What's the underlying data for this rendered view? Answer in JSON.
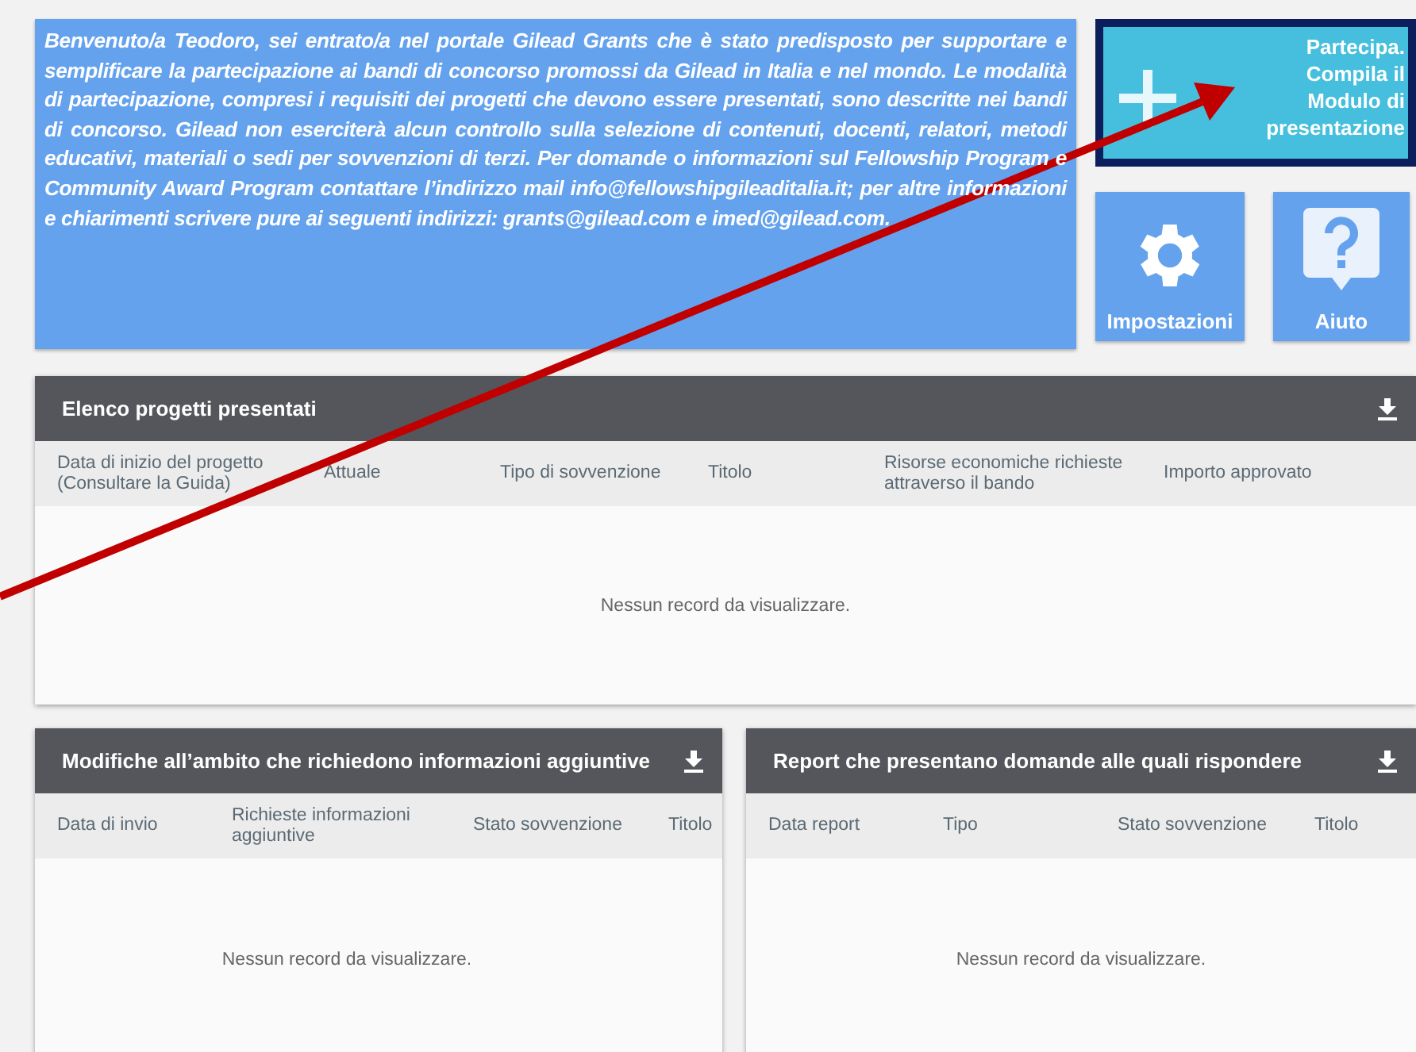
{
  "welcome": {
    "text": "Benvenuto/a Teodoro, sei entrato/a nel portale Gilead Grants che è stato predisposto per supportare e semplificare la partecipazione ai bandi di concorso promossi da Gilead in Italia e nel mondo. Le modalità di partecipazione, compresi i requisiti dei progetti che devono essere presentati, sono descritte nei bandi di concorso. Gilead non eserciterà alcun controllo sulla selezione di contenuti, docenti, relatori, metodi educativi, materiali o sedi per sovvenzioni di terzi. Per domande o informazioni sul Fellowship Program e Community Award Program contattare l’indirizzo mail info@fellowshipgileaditalia.it; per altre informazioni e chiarimenti scrivere pure ai seguenti indirizzi: grants@gilead.com e  imed@gilead.com."
  },
  "actions": [
    {
      "kind": "create",
      "label": "Partecipa. Compila il Modulo di presentazione"
    },
    {
      "kind": "settings",
      "label": "Impostazioni"
    },
    {
      "kind": "help",
      "label": "Aiuto"
    }
  ],
  "panels": [
    {
      "title": "Elenco progetti presentati",
      "columns": [
        "Data di inizio del progetto (Consultare la Guida)",
        "Attuale",
        "Tipo di sovvenzione",
        "Titolo",
        "Risorse economiche richieste attraverso il bando",
        "Importo approvato"
      ],
      "empty_text": "Nessun record da visualizzare."
    },
    {
      "title": "Modifiche all’ambito che richiedono informazioni aggiuntive",
      "columns": [
        "Data di invio",
        "Richieste informazioni aggiuntive",
        "Stato sovvenzione",
        "Titolo"
      ],
      "empty_text": "Nessun record da visualizzare."
    },
    {
      "title": "Report che presentano domande alle quali rispondere",
      "columns": [
        "Data report",
        "Tipo",
        "Stato sovvenzione",
        "Titolo"
      ],
      "empty_text": "Nessun record da visualizzare."
    }
  ]
}
